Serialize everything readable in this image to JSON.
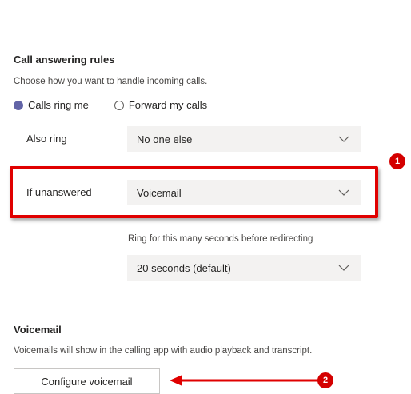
{
  "call_answering": {
    "title": "Call answering rules",
    "description": "Choose how you want to handle incoming calls.",
    "radio_options": [
      {
        "label": "Calls ring me",
        "checked": true
      },
      {
        "label": "Forward my calls",
        "checked": false
      }
    ],
    "also_ring": {
      "label": "Also ring",
      "value": "No one else"
    },
    "if_unanswered": {
      "label": "If unanswered",
      "value": "Voicemail"
    },
    "ring_seconds": {
      "label": "Ring for this many seconds before redirecting",
      "value": "20 seconds (default)"
    }
  },
  "voicemail": {
    "title": "Voicemail",
    "description": "Voicemails will show in the calling app with audio playback and transcript.",
    "configure_button": "Configure voicemail"
  },
  "annotations": {
    "badge_1": "1",
    "badge_2": "2",
    "highlight_color": "#e00000"
  },
  "colors": {
    "accent": "#6264a7",
    "dropdown_bg": "#f3f2f1",
    "text": "#252423"
  },
  "icons": {
    "dropdown": "chevron-down-icon",
    "arrow": "arrow-left-icon"
  }
}
